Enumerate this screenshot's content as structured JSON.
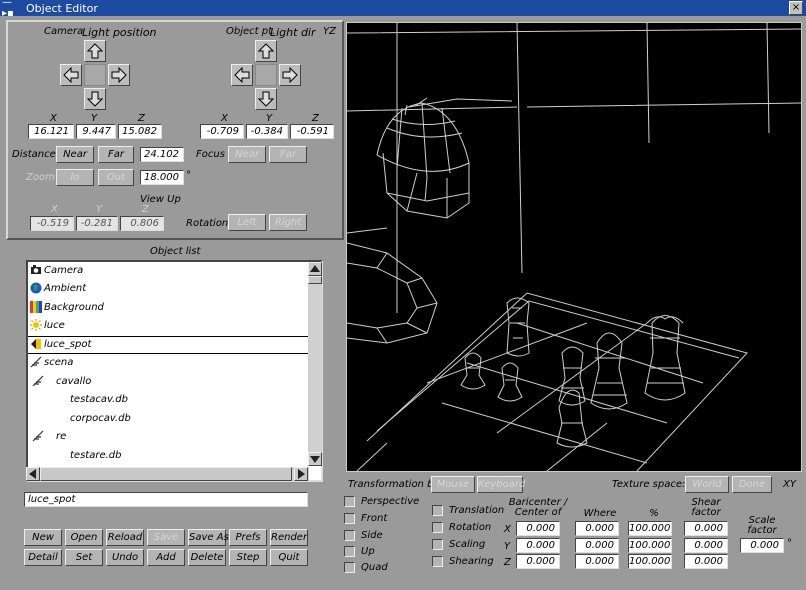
{
  "window": {
    "title": "Object Editor",
    "system_menu": "—▸▪",
    "close_glyph": "×"
  },
  "camera": {
    "header_camera": "Camera",
    "header_light": "Light position",
    "x_label": "X",
    "y_label": "Y",
    "z_label": "Z",
    "x": "16.121",
    "y": "9.447",
    "z": "15.082"
  },
  "object_pt": {
    "header_obj": "Object pt.",
    "header_light": "Light dir",
    "x_label": "X",
    "y_label": "Y",
    "z_label": "Z",
    "x": "-0.709",
    "y": "-0.384",
    "z": "-0.591"
  },
  "plane_label": "YZ",
  "distance": {
    "label": "Distance",
    "near": "Near",
    "far": "Far",
    "value": "24.102"
  },
  "focus": {
    "label": "Focus",
    "near": "Near",
    "far": "Far"
  },
  "zoom": {
    "label": "Zoom",
    "in": "In",
    "out": "Out",
    "value": "18.000",
    "unit": "°"
  },
  "view_up": {
    "label": "View Up",
    "x_label": "X",
    "y_label": "Y",
    "z_label": "Z",
    "x": "-0.519",
    "y": "-0.281",
    "z": "0.806"
  },
  "rotation": {
    "label": "Rotation",
    "left": "Left",
    "right": "Right"
  },
  "object_list": {
    "title": "Object list",
    "items": [
      "Camera",
      "Ambient",
      "Background",
      "luce",
      "luce_spot",
      "scena",
      "cavallo",
      "testacav.db",
      "corpocav.db",
      "re",
      "testare.db"
    ],
    "selected": "luce_spot"
  },
  "name_field": "luce_spot",
  "buttons_row1": [
    "New",
    "Open",
    "Reload",
    "Save",
    "Save As",
    "Prefs",
    "Render"
  ],
  "buttons_row2": [
    "Detail",
    "Set",
    "Undo",
    "Add",
    "Delete",
    "Step",
    "Quit"
  ],
  "transformation": {
    "label": "Transformation by:",
    "mouse": "Mouse",
    "keyboard": "Keyboard"
  },
  "texture": {
    "label": "Texture space:",
    "world": "World",
    "done": "Done",
    "axes": "XY"
  },
  "view_options": [
    "Perspective",
    "Front",
    "Side",
    "Up",
    "Quad"
  ],
  "transform_modes": [
    "Translation",
    "Rotation",
    "Scaling",
    "Shearing"
  ],
  "grid": {
    "col_barycenter": "Baricenter / Center of",
    "col_where": "Where",
    "col_percent": "%",
    "col_shear": "Shear factor",
    "col_scale": "Scale factor",
    "row_labels": [
      "X",
      "Y",
      "Z"
    ],
    "rows": [
      [
        "0.000",
        "0.000",
        "100.000",
        "0.000"
      ],
      [
        "0.000",
        "0.000",
        "100.000",
        "0.000"
      ],
      [
        "0.000",
        "0.000",
        "100.000",
        "0.000"
      ]
    ],
    "scale_value": "0.000",
    "scale_unit": "°"
  }
}
